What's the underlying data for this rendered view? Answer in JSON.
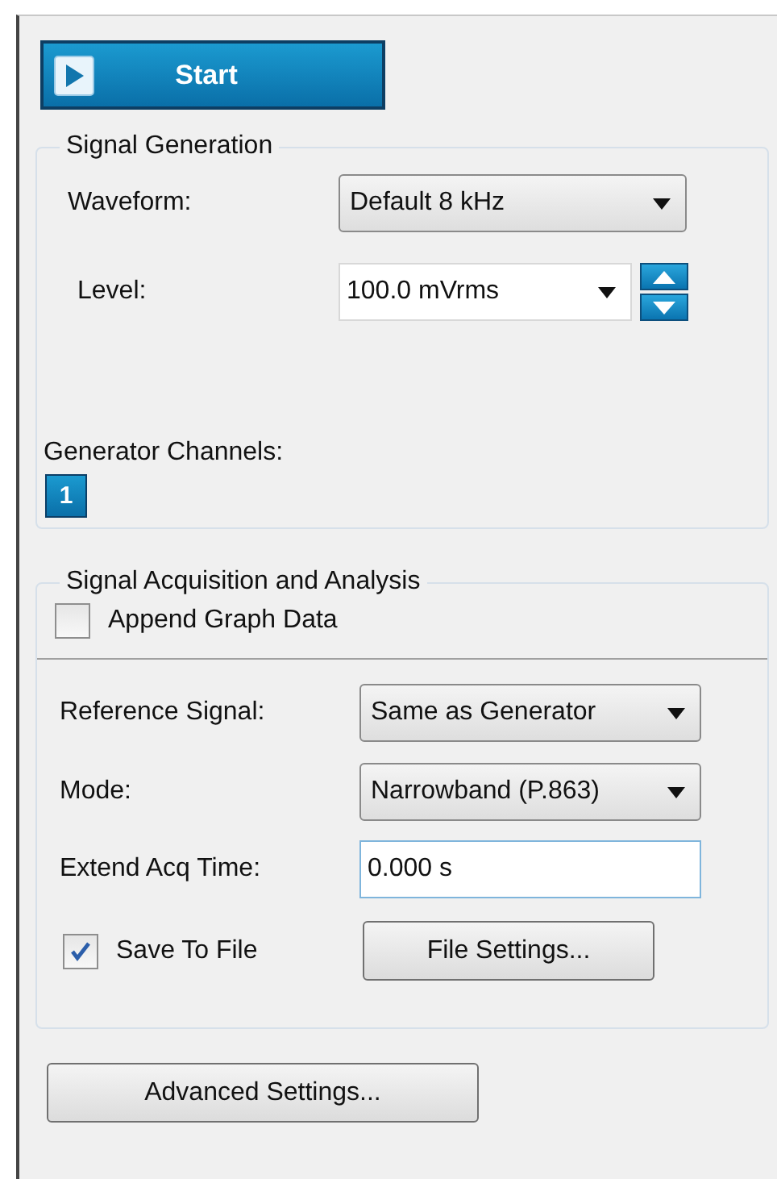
{
  "start_button": {
    "label": "Start"
  },
  "signal_generation": {
    "title": "Signal Generation",
    "waveform": {
      "label": "Waveform:",
      "value": "Default 8 kHz"
    },
    "level": {
      "label": "Level:",
      "value": "100.0 mVrms"
    },
    "generator_channels": {
      "label": "Generator Channels:",
      "channels": [
        {
          "label": "1",
          "selected": true
        }
      ]
    }
  },
  "signal_acquisition": {
    "title": "Signal Acquisition and Analysis",
    "append_graph_data": {
      "label": "Append Graph Data",
      "checked": false
    },
    "reference_signal": {
      "label": "Reference Signal:",
      "value": "Same as Generator"
    },
    "mode": {
      "label": "Mode:",
      "value": "Narrowband (P.863)"
    },
    "extend_acq_time": {
      "label": "Extend Acq Time:",
      "value": "0.000 s"
    },
    "save_to_file": {
      "label": "Save To File",
      "checked": true
    },
    "file_settings_button": "File Settings..."
  },
  "advanced_settings_button": "Advanced Settings..."
}
